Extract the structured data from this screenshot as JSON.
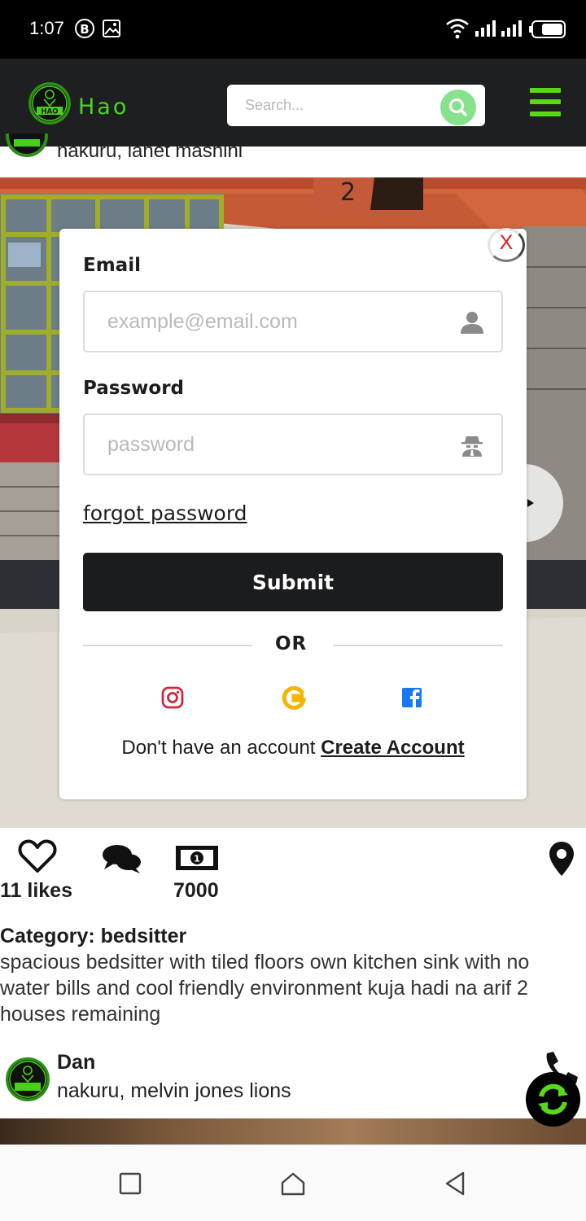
{
  "status_bar": {
    "time": "1:07",
    "icons": [
      "b-circle-icon",
      "image-icon",
      "wifi-icon",
      "signal-icon",
      "signal-icon",
      "battery-icon"
    ]
  },
  "header": {
    "brand": "Hao",
    "logo_text": "HAO",
    "search_placeholder": "Search...",
    "accent_color": "#57d91a"
  },
  "feed": {
    "previous_post_location": "nakuru, lanet mashini",
    "stats": {
      "likes": "11 likes",
      "price": "7000"
    },
    "category_label": "Category: bedsitter",
    "description": "spacious bedsitter with tiled floors own kitchen sink with no water bills and cool friendly environment kuja hadi na arif 2 houses remaining",
    "next_post": {
      "author": "Dan",
      "location": "nakuru, melvin jones lions"
    }
  },
  "login_modal": {
    "close_label": "X",
    "email_label": "Email",
    "email_placeholder": "example@email.com",
    "password_label": "Password",
    "password_placeholder": "password",
    "forgot_label": "forgot password",
    "submit_label": "Submit",
    "or_label": "OR",
    "social_icons": [
      "instagram-icon",
      "google-icon",
      "facebook-icon"
    ],
    "signup_prompt": "Don't have an account",
    "signup_link": "Create Account"
  }
}
